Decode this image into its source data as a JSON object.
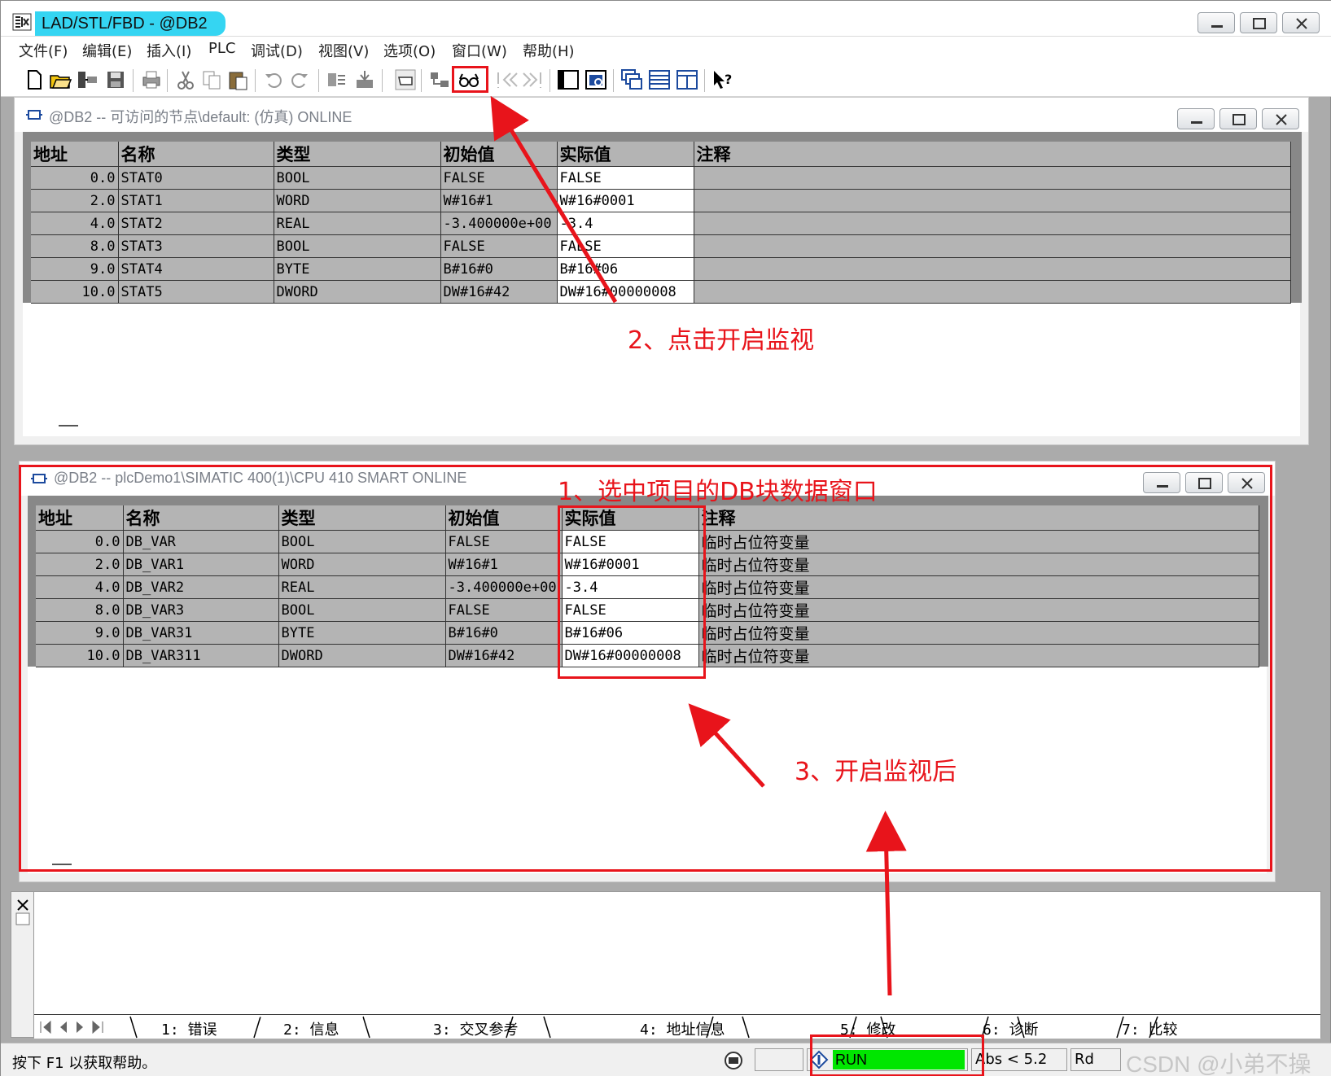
{
  "app": {
    "title": "LAD/STL/FBD  - @DB2"
  },
  "menu": [
    "文件(F)",
    "编辑(E)",
    "插入(I)",
    "PLC",
    "调试(D)",
    "视图(V)",
    "选项(O)",
    "窗口(W)",
    "帮助(H)"
  ],
  "window_top": {
    "title": "@DB2 -- 可访问的节点\\default:  (仿真)  ONLINE",
    "headers": [
      "地址",
      "名称",
      "类型",
      "初始值",
      "实际值",
      "注释"
    ],
    "rows": [
      [
        "0.0",
        "STAT0",
        "BOOL",
        "FALSE",
        "FALSE",
        ""
      ],
      [
        "2.0",
        "STAT1",
        "WORD",
        "W#16#1",
        "W#16#0001",
        ""
      ],
      [
        "4.0",
        "STAT2",
        "REAL",
        "-3.400000e+00",
        "-3.4",
        ""
      ],
      [
        "8.0",
        "STAT3",
        "BOOL",
        "FALSE",
        "FALSE",
        ""
      ],
      [
        "9.0",
        "STAT4",
        "BYTE",
        "B#16#0",
        "B#16#06",
        ""
      ],
      [
        "10.0",
        "STAT5",
        "DWORD",
        "DW#16#42",
        "DW#16#00000008",
        ""
      ]
    ]
  },
  "window_bottom": {
    "title": "@DB2 -- plcDemo1\\SIMATIC 400(1)\\CPU 410 SMART  ONLINE",
    "headers": [
      "地址",
      "名称",
      "类型",
      "初始值",
      "实际值",
      "注释"
    ],
    "rows": [
      [
        "0.0",
        "DB_VAR",
        "BOOL",
        "FALSE",
        "FALSE",
        "临时占位符变量"
      ],
      [
        "2.0",
        "DB_VAR1",
        "WORD",
        "W#16#1",
        "W#16#0001",
        "临时占位符变量"
      ],
      [
        "4.0",
        "DB_VAR2",
        "REAL",
        "-3.400000e+00",
        "-3.4",
        "临时占位符变量"
      ],
      [
        "8.0",
        "DB_VAR3",
        "BOOL",
        "FALSE",
        "FALSE",
        "临时占位符变量"
      ],
      [
        "9.0",
        "DB_VAR31",
        "BYTE",
        "B#16#0",
        "B#16#06",
        "临时占位符变量"
      ],
      [
        "10.0",
        "DB_VAR311",
        "DWORD",
        "DW#16#42",
        "DW#16#00000008",
        "临时占位符变量"
      ]
    ]
  },
  "output_tabs": [
    "1: 错误",
    "2: 信息",
    "3: 交叉参考",
    "4: 地址信息",
    "5: 修改",
    "6: 诊断",
    "7: 比较"
  ],
  "status": {
    "help": "按下 F1 以获取帮助。",
    "mode": "RUN",
    "abs": "Abs < 5.2",
    "rd": "Rd",
    "watermark": "CSDN @小弟不操"
  },
  "annotations": {
    "step1": "1、选中项目的DB块数据窗口",
    "step2": "2、点击开启监视",
    "step3": "3、开启监视后"
  },
  "colors": {
    "accent": "#35d5f2",
    "annotation": "#e8141b",
    "run": "#00e600"
  },
  "icons": [
    "new-icon",
    "open-icon",
    "online-icon",
    "save-icon",
    "print-icon",
    "cut-icon",
    "copy-icon",
    "paste-icon",
    "undo-icon",
    "redo-icon",
    "compile-icon",
    "download-icon",
    "monitor-window-icon",
    "network-icon",
    "monitor-glasses-icon",
    "prev-error-icon",
    "next-error-icon",
    "overview-icon",
    "detail-icon",
    "cascade-icon",
    "tile-horizontal-icon",
    "tile-vertical-icon",
    "context-help-icon"
  ]
}
